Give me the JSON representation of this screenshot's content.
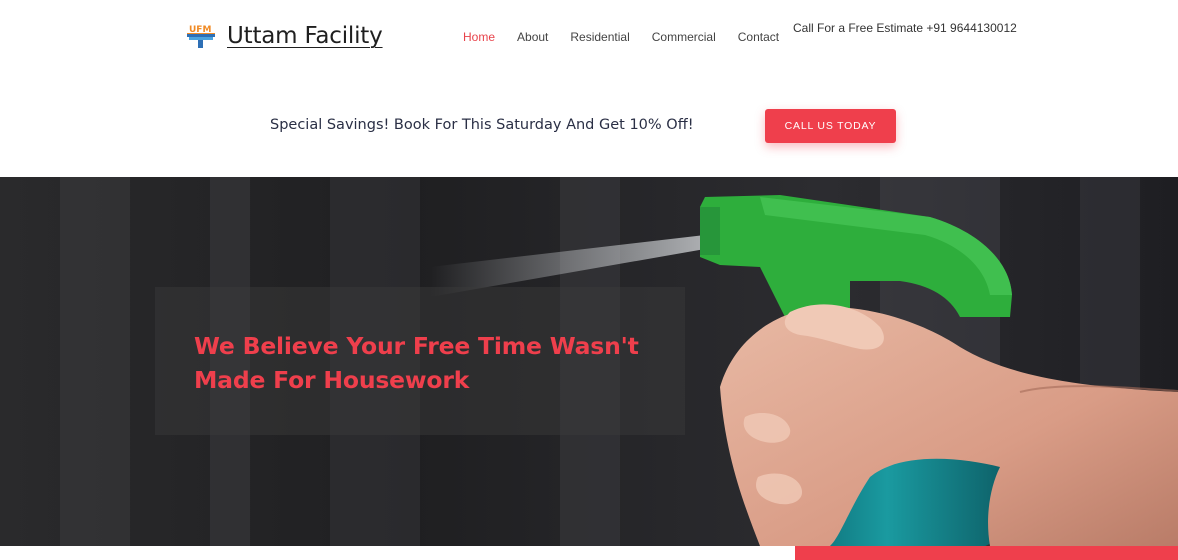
{
  "brand": {
    "logo_text": "UFM",
    "name": "Uttam Facility"
  },
  "nav": {
    "items": [
      {
        "label": "Home",
        "active": true
      },
      {
        "label": "About",
        "active": false
      },
      {
        "label": "Residential",
        "active": false
      },
      {
        "label": "Commercial",
        "active": false
      },
      {
        "label": "Contact",
        "active": false
      }
    ]
  },
  "contact": {
    "call_text": "Call For a Free Estimate +91 9644130012"
  },
  "promo": {
    "text": "Special Savings! Book For This Saturday And Get 10% Off!",
    "button_label": "CALL US TODAY"
  },
  "hero": {
    "heading": "We Believe Your Free Time Wasn't Made For Housework"
  },
  "colors": {
    "accent": "#ef3f4c",
    "active_nav": "#e8434b",
    "spray_green": "#2eae3c",
    "bottle_teal": "#1a9aa0"
  },
  "icons": {
    "logo": "ufm-brush-logo-icon"
  }
}
